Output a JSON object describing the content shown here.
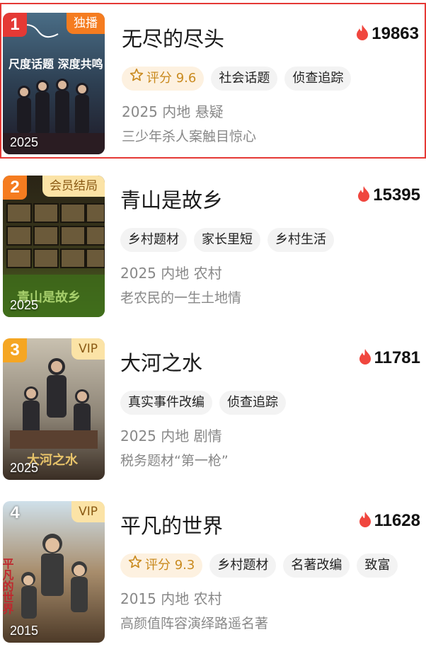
{
  "items": [
    {
      "rank": "1",
      "badge": "独播",
      "title": "无尽的尽头",
      "heat": "19863",
      "score_label": "评分 9.6",
      "tags": [
        "社会话题",
        "侦查追踪"
      ],
      "meta": "2025 内地 悬疑",
      "desc": "三少年杀人案触目惊心",
      "poster_year": "2025",
      "poster_text": "尺度话题 深度共鸣"
    },
    {
      "rank": "2",
      "badge": "会员结局",
      "title": "青山是故乡",
      "heat": "15395",
      "tags": [
        "乡村题材",
        "家长里短",
        "乡村生活"
      ],
      "meta": "2025 内地 农村",
      "desc": "老农民的一生土地情",
      "poster_year": "2025",
      "poster_text": "青山是故乡"
    },
    {
      "rank": "3",
      "badge": "VIP",
      "title": "大河之水",
      "heat": "11781",
      "tags": [
        "真实事件改编",
        "侦查追踪"
      ],
      "meta": "2025 内地 剧情",
      "desc": "税务题材“第一枪”",
      "poster_year": "2025",
      "poster_text": "大河之水"
    },
    {
      "rank": "4",
      "badge": "VIP",
      "title": "平凡的世界",
      "heat": "11628",
      "score_label": "评分 9.3",
      "tags": [
        "乡村题材",
        "名著改编",
        "致富"
      ],
      "meta": "2015 内地 农村",
      "desc": "高颜值阵容演绎路遥名著",
      "poster_year": "2015",
      "poster_text": "平凡的世界"
    }
  ],
  "colors": {
    "rank1": "#e53935",
    "rank2": "#f57c20",
    "rank3": "#f5a623",
    "badge_exclusive": "#f57c20",
    "badge_vip_bg": "#fbe3a6",
    "badge_vip_fg": "#8a5a14",
    "flame": "#f0463e",
    "selection_border": "#e53935"
  },
  "icons": {
    "heat": "flame-icon",
    "score": "star-outline-icon"
  }
}
